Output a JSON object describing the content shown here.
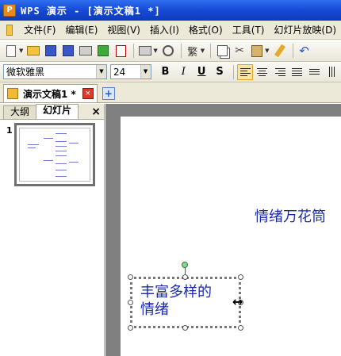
{
  "window": {
    "title": "WPS 演示 - [演示文稿1 *]",
    "app_icon_letter": "P"
  },
  "menu": [
    "文件(F)",
    "编辑(E)",
    "视图(V)",
    "插入(I)",
    "格式(O)",
    "工具(T)",
    "幻灯片放映(D)"
  ],
  "toolbar": {
    "traditional_label": "繁"
  },
  "format": {
    "font_name": "微软雅黑",
    "font_size": "24",
    "bold": "B",
    "italic": "I",
    "underline": "U",
    "shadow": "S"
  },
  "doc_tab": {
    "label": "演示文稿1 *",
    "close": "×",
    "add": "+"
  },
  "panel": {
    "tabs": [
      "大纲",
      "幻灯片"
    ],
    "active_tab": 1,
    "close": "×"
  },
  "slides": [
    {
      "number": "1"
    }
  ],
  "slide": {
    "node_text": "情绪万花筒",
    "selected_text_line1": "丰富多样的",
    "selected_text_line2": "情绪"
  },
  "colors": {
    "slide_text": "#1a2aa8",
    "titlebar": "#1549d6"
  }
}
